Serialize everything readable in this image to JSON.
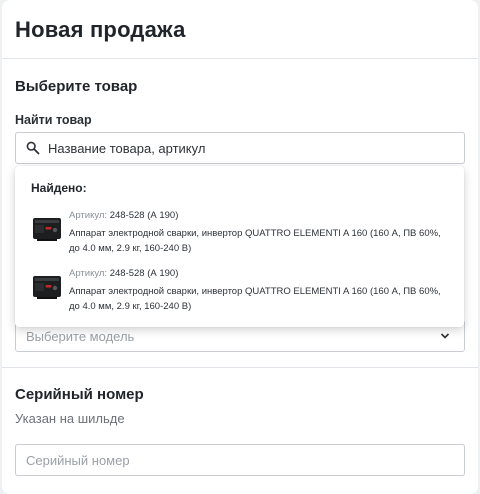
{
  "header": {
    "title": "Новая продажа"
  },
  "product_section": {
    "title": "Выберите товар",
    "search_label": "Найти товар",
    "search_value": "Название товара, артикул"
  },
  "dropdown": {
    "found_label": "Найдено:",
    "results": [
      {
        "sku_label": "Артикул:",
        "sku_value": "248-528 (А 190)",
        "description": "Аппарат электродной сварки, инвертор QUATTRO ELEMENTI A 160 (160 А, ПВ 60%, до 4.0 мм, 2.9 кг, 160-240 В)"
      },
      {
        "sku_label": "Артикул:",
        "sku_value": "248-528 (А 190)",
        "description": "Аппарат электродной сварки, инвертор QUATTRO ELEMENTI A 160 (160 А, ПВ 60%, до 4.0 мм, 2.9 кг, 160-240 В)"
      }
    ]
  },
  "model_select": {
    "placeholder": "Выберите модель"
  },
  "serial_section": {
    "title": "Серийный номер",
    "hint": "Указан на шильде",
    "placeholder": "Серийный номер"
  },
  "icons": {
    "search": "search-icon",
    "chevron": "chevron-down-icon",
    "thumb": "welder-thumbnail-icon"
  }
}
